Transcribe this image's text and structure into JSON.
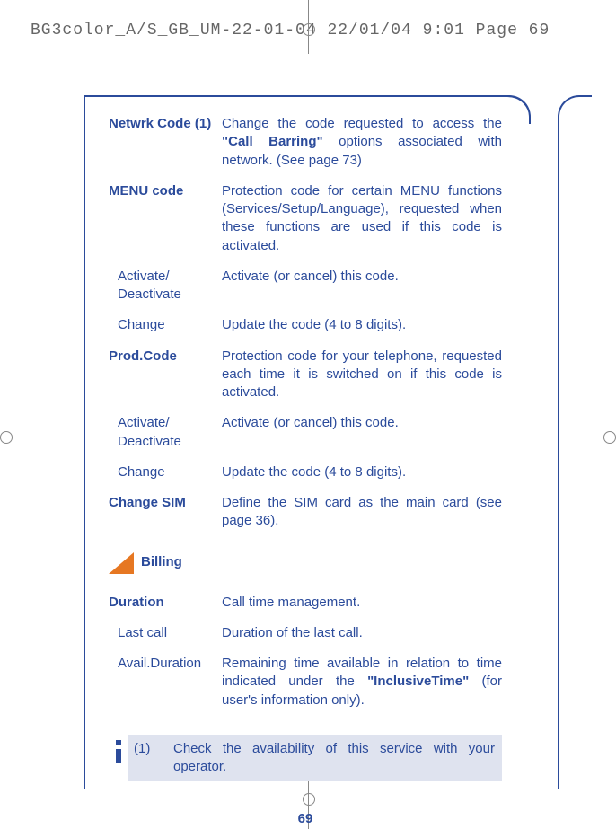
{
  "header": {
    "slug": "BG3color_A/S_GB_UM-22-01-04  22/01/04  9:01  Page 69"
  },
  "items": [
    {
      "label": "Netwrk Code (1)",
      "bold": true,
      "sub": false,
      "desc_pre": "Change the code requested to access the ",
      "desc_em": "\"Call Barring\"",
      "desc_post": " options associated with network. (See page 73)"
    },
    {
      "label": "MENU code",
      "bold": true,
      "sub": false,
      "desc": "Protection code for certain MENU functions (Services/Setup/Language), requested when these functions are used if this code is activated."
    },
    {
      "label": "Activate/ Deactivate",
      "bold": false,
      "sub": true,
      "desc": "Activate (or cancel) this code."
    },
    {
      "label": "Change",
      "bold": false,
      "sub": true,
      "desc": "Update the code (4 to 8 digits)."
    },
    {
      "label": "Prod.Code",
      "bold": true,
      "sub": false,
      "desc": "Protection code for your telephone, requested each time it is switched on if this code is activated."
    },
    {
      "label": "Activate/ Deactivate",
      "bold": false,
      "sub": true,
      "desc": "Activate (or cancel) this code."
    },
    {
      "label": "Change",
      "bold": false,
      "sub": true,
      "desc": "Update the code (4 to 8 digits)."
    },
    {
      "label": "Change SIM",
      "bold": true,
      "sub": false,
      "desc": "Define the SIM card as the main card (see page 36)."
    }
  ],
  "section": {
    "title": "Billing"
  },
  "billing_items": [
    {
      "label": "Duration",
      "bold": true,
      "sub": false,
      "desc": "Call time management."
    },
    {
      "label": "Last call",
      "bold": false,
      "sub": true,
      "desc": "Duration of the last call."
    },
    {
      "label": "Avail.Duration",
      "bold": false,
      "sub": true,
      "desc_pre": "Remaining time available in relation to time indicated under the ",
      "desc_em": "\"InclusiveTime\"",
      "desc_post": " (for user's information only)."
    }
  ],
  "footnote": {
    "num": "(1)",
    "text": "Check the availability of this service with your operator."
  },
  "page_number": "69"
}
